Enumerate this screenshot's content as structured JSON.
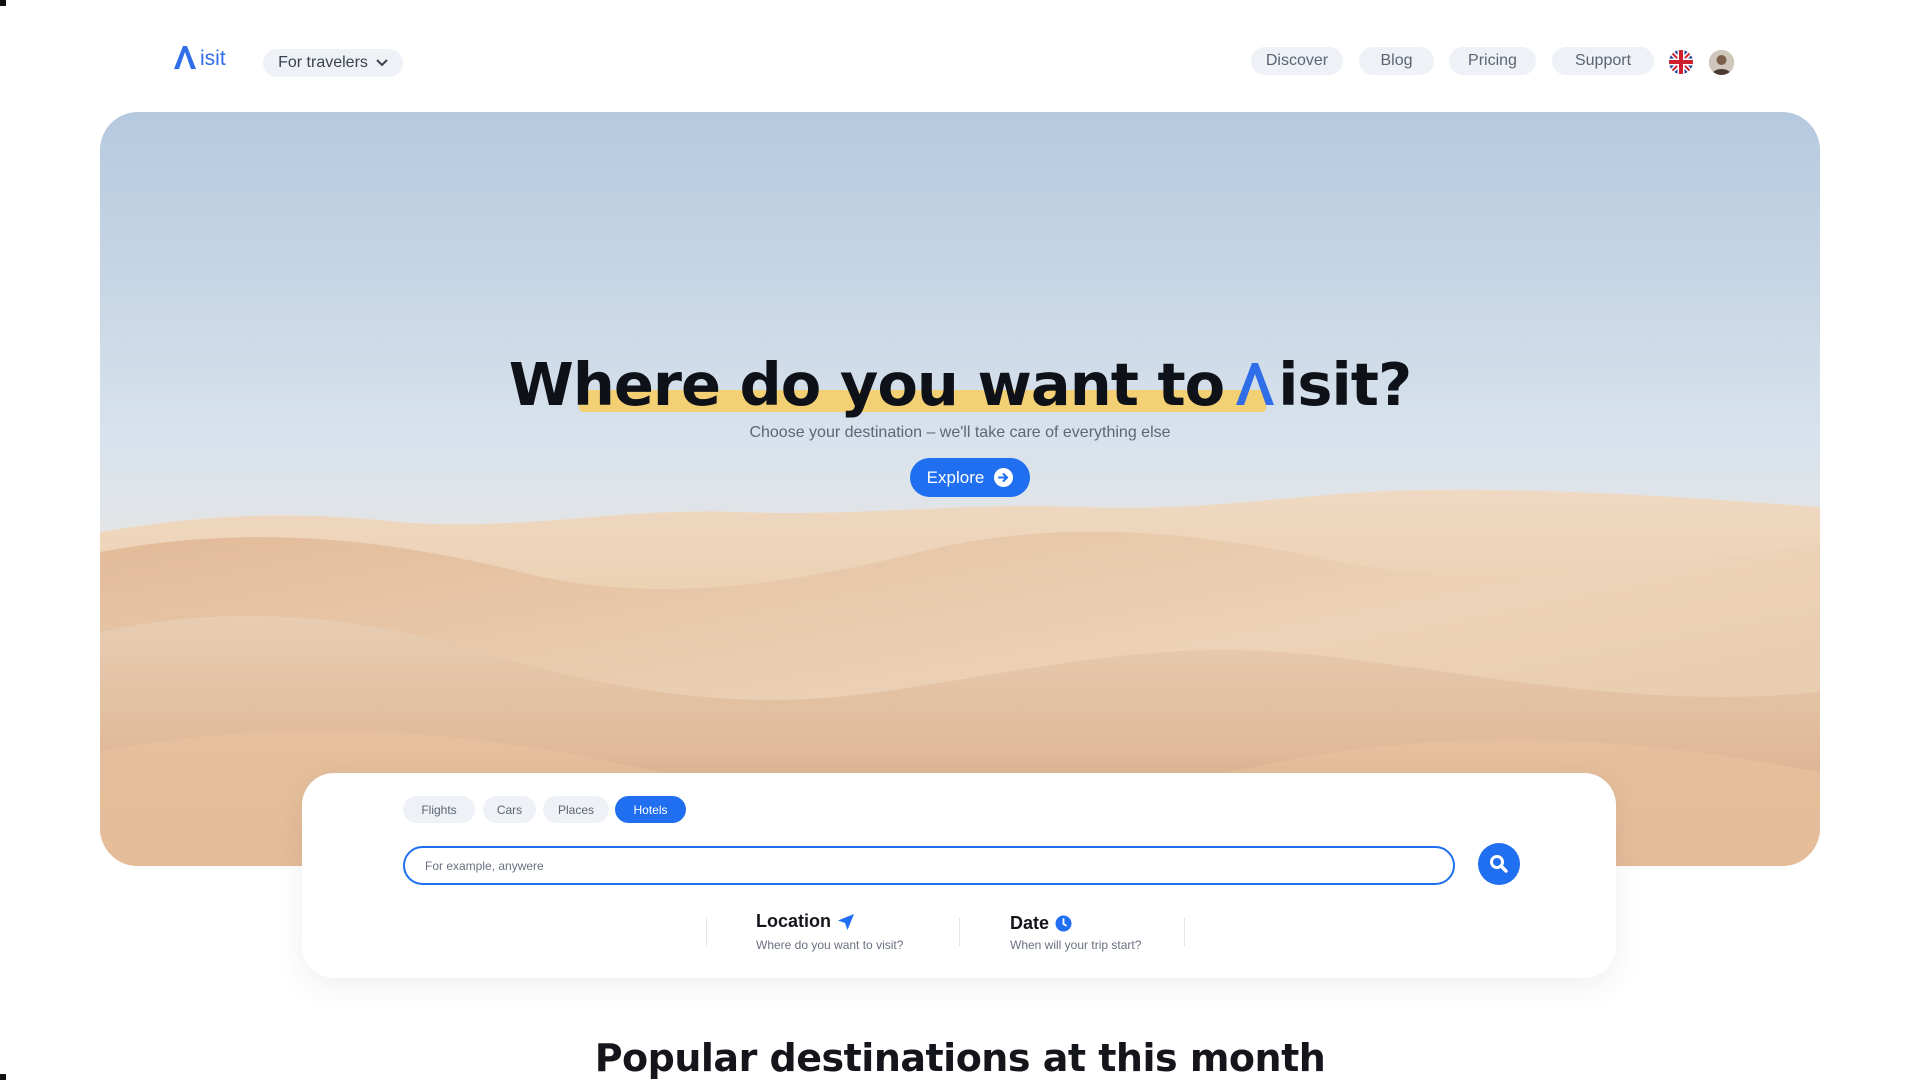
{
  "header": {
    "logo_text": "isit",
    "audience_label": "For travelers",
    "nav": {
      "discover": "Discover",
      "blog": "Blog",
      "pricing": "Pricing",
      "support": "Support"
    }
  },
  "hero": {
    "title_before": "Where do you want to",
    "title_after": "isit?",
    "subtitle": "Choose your destination – we'll take care of everything else",
    "explore_label": "Explore"
  },
  "search": {
    "tabs": {
      "flights": "Flights",
      "cars": "Cars",
      "places": "Places",
      "hotels": "Hotels"
    },
    "active_tab": "Hotels",
    "input_value": "",
    "input_placeholder": "For example, anywere",
    "location_title": "Location",
    "location_sub": "Where do you want to visit?",
    "date_title": "Date",
    "date_sub": "When will your trip start?"
  },
  "popular": {
    "title": "Popular destinations at this month"
  },
  "colors": {
    "accent": "#1f6ff0",
    "highlight": "#f4cf6e",
    "pill_bg": "#eef1f6"
  }
}
